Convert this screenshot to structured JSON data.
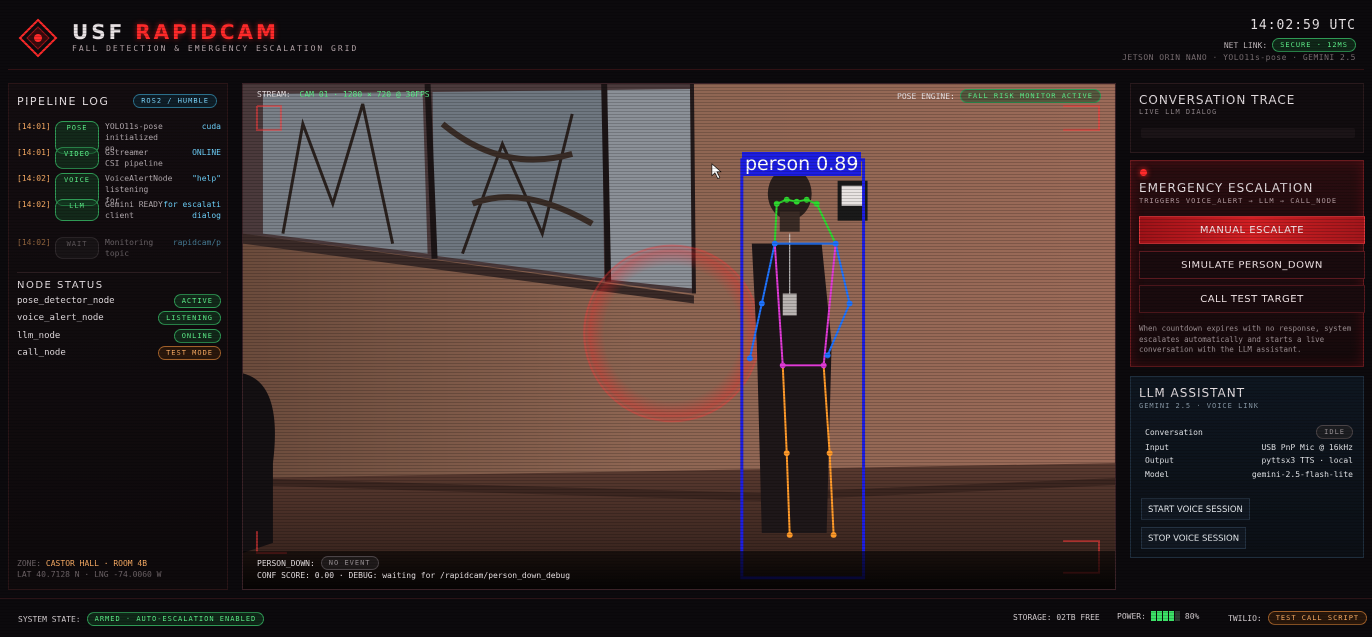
{
  "header": {
    "title_main": "USF",
    "title_accent": "RAPIDCAM",
    "subtitle": "FALL DETECTION & EMERGENCY ESCALATION GRID",
    "clock": "14:02:59 UTC",
    "netlink_label": "NET LINK:",
    "netlink_status": "SECURE · 12MS",
    "hardware": "JETSON ORIN NANO · YOLO11s-pose · GEMINI 2.5"
  },
  "pipeline": {
    "title": "PIPELINE LOG",
    "badge": "ROS2 / HUMBLE",
    "entries": [
      {
        "time": "[14:01]",
        "tag": "POSE",
        "message": "YOLO11s-pose initialized on",
        "value": "cuda"
      },
      {
        "time": "[14:01]",
        "tag": "VIDEO",
        "message": "GStreamer CSI pipeline",
        "value": "ONLINE"
      },
      {
        "time": "[14:02]",
        "tag": "VOICE",
        "message": "VoiceAlertNode listening for",
        "value": "\"help\""
      },
      {
        "time": "[14:02]",
        "tag": "LLM",
        "message": "Gemini READY client",
        "value": "for escalati dialog"
      },
      {
        "time": "[14:02]",
        "tag": "WAIT",
        "message": "Monitoring topic",
        "value": "rapidcam/p"
      }
    ]
  },
  "node_status": {
    "title": "NODE STATUS",
    "nodes": [
      {
        "name": "pose_detector_node",
        "status": "ACTIVE"
      },
      {
        "name": "voice_alert_node",
        "status": "LISTENING"
      },
      {
        "name": "llm_node",
        "status": "ONLINE"
      },
      {
        "name": "call_node",
        "status": "TEST MODE"
      }
    ]
  },
  "location": {
    "zone_label": "ZONE:",
    "zone_value": "CASTOR HALL · ROOM 4B",
    "coords": "LAT  40.7128 N · LNG  -74.0060 W"
  },
  "camera": {
    "stream_label": "STREAM:",
    "stream_value": "CAM 01 · 1280 × 720 @ 30FPS",
    "pose_engine_label": "POSE ENGINE:",
    "pose_engine_status": "FALL RISK MONITOR ACTIVE",
    "detection_label": "person  0.89",
    "person_down_label": "PERSON_DOWN:",
    "person_down_status": "NO EVENT",
    "conf_line": "CONF SCORE: 0.00 · DEBUG: waiting for /rapidcam/person_down_debug"
  },
  "conversation": {
    "title": "CONVERSATION TRACE",
    "subtitle": "LIVE LLM DIALOG"
  },
  "emergency": {
    "title": "EMERGENCY ESCALATION",
    "subtitle": "TRIGGERS VOICE_ALERT → LLM → CALL_NODE",
    "manual_button": "MANUAL ESCALATE",
    "simulate_button": "SIMULATE PERSON_DOWN",
    "call_test_button": "CALL TEST TARGET",
    "note": "When countdown expires with no response, system escalates automatically and starts a live conversation with the LLM assistant."
  },
  "llm": {
    "title": "LLM ASSISTANT",
    "subtitle": "GEMINI 2.5 · VOICE LINK",
    "conversation_label": "Conversation",
    "conversation_status": "IDLE",
    "rows": [
      {
        "label": "Input",
        "value": "USB PnP Mic @ 16kHz"
      },
      {
        "label": "Output",
        "value": "pyttsx3 TTS · local"
      },
      {
        "label": "Model",
        "value": "gemini-2.5-flash-lite"
      }
    ],
    "start_button": "START VOICE SESSION",
    "stop_button": "STOP VOICE SESSION"
  },
  "footer": {
    "system_state_label": "SYSTEM STATE:",
    "system_state_value": "ARMED · AUTO-ESCALATION ENABLED",
    "storage": "STORAGE: 02TB FREE",
    "power_label": "POWER:",
    "power_value": "80%",
    "power_level": 0.8,
    "twilio_label": "TWILIO:",
    "twilio_value": "TEST CALL SCRIPT"
  },
  "colors": {
    "accent_red": "#ff2a2a",
    "status_green": "#5ef08a",
    "status_cyan": "#7fd9ff",
    "status_orange": "#ffb066",
    "bbox_blue": "#1d1ee3"
  }
}
